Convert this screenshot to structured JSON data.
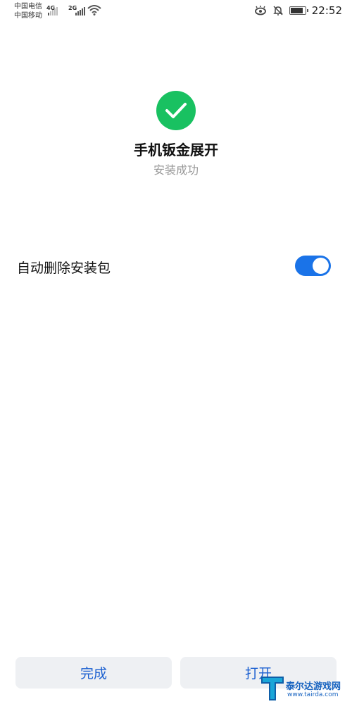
{
  "status_bar": {
    "carrier_1": "中国电信",
    "carrier_2": "中国移动",
    "net_1": "4G",
    "net_2": "2G",
    "time": "22:52"
  },
  "result": {
    "app_name": "手机钣金展开",
    "status": "安装成功"
  },
  "settings": {
    "auto_delete_label": "自动删除安装包",
    "auto_delete_enabled": true
  },
  "buttons": {
    "done": "完成",
    "open": "打开"
  },
  "watermark": {
    "title": "泰尔达游戏网",
    "url": "www.tairda.com"
  },
  "colors": {
    "success": "#19c161",
    "toggle_on": "#1a73e8",
    "button_text": "#1a5fd0"
  }
}
